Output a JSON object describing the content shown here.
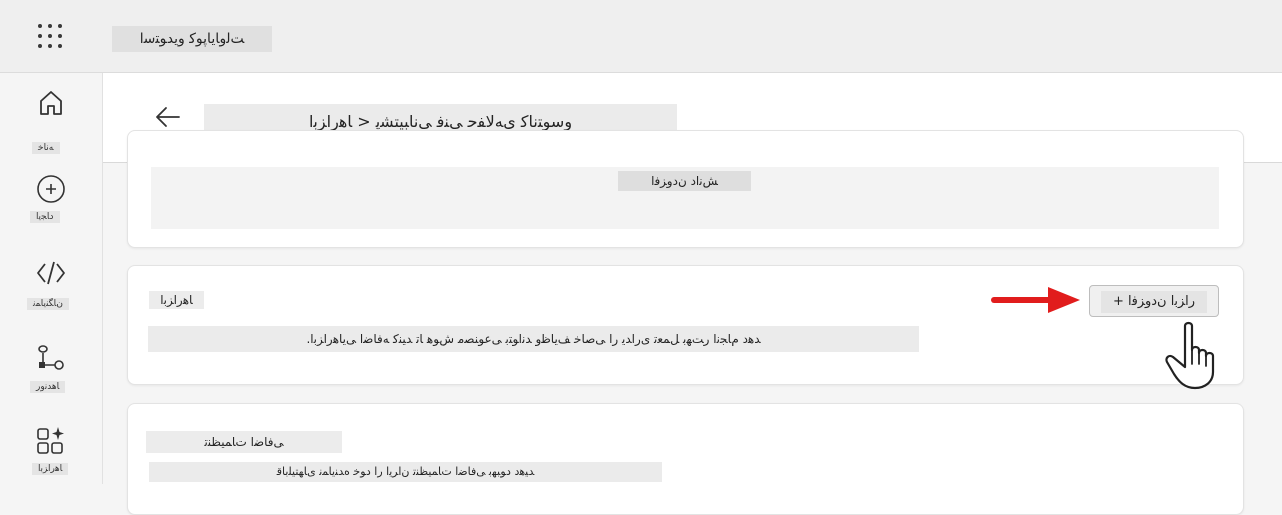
{
  "topbar": {
    "app_title": "ﺖﻟﻭﺎﯾﺎﭘﻮﮐ ﻭﯾﺪﻮﺘﺳﺍ"
  },
  "sidebar": {
    "items": [
      {
        "label": "ﻪﻧﺎﺧ",
        "icon": "home-icon"
      },
      {
        "label": "ﺩﺎﺠﯾﺍ",
        "icon": "create-icon"
      },
      {
        "label": "ﻥﺎﮕﻨﯾﺎﻤﻧ",
        "icon": "code-icon"
      },
      {
        "label": "ﺎﻫﺪﻧﻭﺭ",
        "icon": "flow-icon"
      },
      {
        "label": "ﺎﻫﺭﺍﺰﺑﺍ",
        "icon": "apps-sparkle-icon"
      }
    ]
  },
  "header": {
    "breadcrumb": "ﻭﺳﻮﺘﻧﺎﮐ ﯼﻪﻟﺎﻔﺣ ﯽﻨﻓ ﯽﻧﺎﺒﯿﺘﺸﭘ < ﺎﻫﺭﺍﺰﺑﺍ"
  },
  "cards": {
    "knowledge": {
      "add_data_label": "ﺶﻧﺍﺩ ﻥﺩﻭﺰﻓﺍ"
    },
    "tools": {
      "title": "ﺎﻫﺭﺍﺰﺑﺍ",
      "description": "ﺪﻫﺩ ﻡﺎﺠﻧﺍ ﺭﺖﻬﺑ ﻞﻤﻌﺗ ﯼﺭﺍﺪﯾ ﺭﺍ ﯽﺻﺎﺧ ﻒﯾﺎﻇﻭ ﺪﻧﺍﻮﺘﺑ ﯽﻋﻮﻨﺼﻣ ﺵﻮﻫ ﺎﺗ ﺪﯿﻨﮐ ﻪﻓﺎﺿﺍ ﯽﯾﺎﻫﺭﺍﺰﺑﺍ.",
      "add_tool_label": "ﺭﺍﺰﺑﺍ ﻥﺩﻭﺰﻓﺍ +"
    },
    "agent_settings": {
      "title": "ﯽﻓﺎﺿﺍ ﺕﺎﻤﯿﻈﻨﺗ",
      "description": "ﺪﯿﻫﺩ ﺩﻮﺒﻬﺑ ﯽﻓﺎﺿﺍ ﺕﺎﻤﯿﻈﻨﺗ ﻥﺍﺮﯾﺍ ﺭﺍ ﺩﻮﺧ ﻩﺪﻨﯾﺎﻤﻧ ﯼﺎﻬﺘﯿﻠﺑﺎﻗ"
    }
  },
  "colors": {
    "arrow": "#e11d1d",
    "card_bg": "#ffffff",
    "page_bg": "#f5f5f5"
  }
}
